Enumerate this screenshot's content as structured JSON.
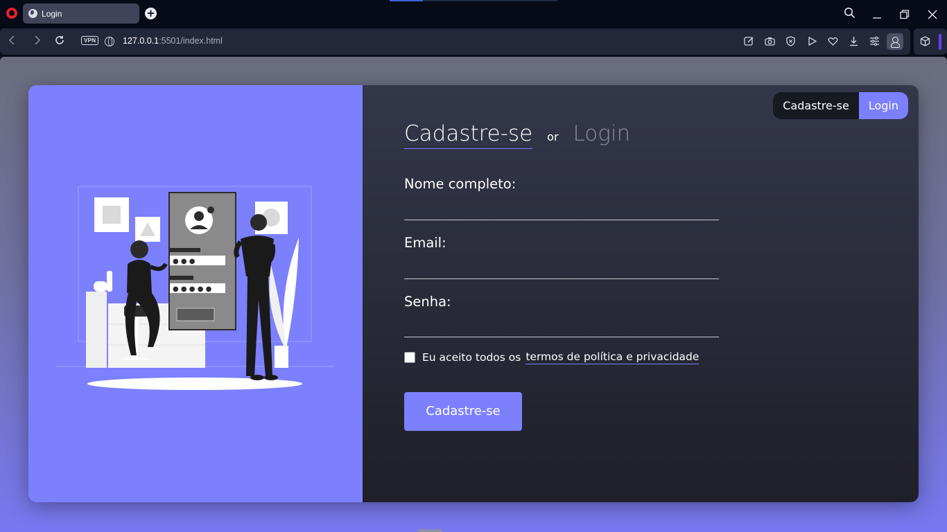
{
  "browser": {
    "tab_title": "Login",
    "url_host": "127.0.0.1",
    "url_rest": ":5501/index.html",
    "vpn_label": "VPN"
  },
  "page": {
    "switcher": {
      "signup": "Cadastre-se",
      "login": "Login"
    },
    "heading": {
      "signup": "Cadastre-se",
      "or": "or",
      "login": "Login"
    },
    "fields": [
      {
        "label": "Nome completo:",
        "value": ""
      },
      {
        "label": "Email:",
        "value": ""
      },
      {
        "label": "Senha:",
        "value": ""
      }
    ],
    "terms": {
      "text": "Eu aceito todos os",
      "link": "termos de política e privacidade",
      "checked": false
    },
    "submit_label": "Cadastre-se"
  },
  "colors": {
    "accent": "#7c80fd",
    "panel_dark": "#1e1f29"
  }
}
